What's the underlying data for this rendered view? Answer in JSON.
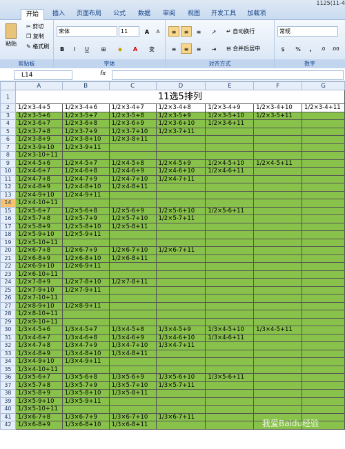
{
  "window": {
    "title_fragment": "1125(11-4"
  },
  "tabs": [
    "开始",
    "插入",
    "页面布局",
    "公式",
    "数据",
    "审阅",
    "视图",
    "开发工具",
    "加载项"
  ],
  "ribbon": {
    "clipboard": {
      "paste": "粘贴",
      "cut": "剪切",
      "copy": "复制",
      "format_painter": "格式刷",
      "label": "剪贴板"
    },
    "font": {
      "name": "宋体",
      "size": "11",
      "bold": "B",
      "italic": "I",
      "underline": "U",
      "grow": "A",
      "shrink": "A",
      "wen": "变",
      "label": "字体"
    },
    "alignment": {
      "wrap": "自动换行",
      "merge": "合并后居中",
      "label": "对齐方式"
    },
    "number": {
      "format": "常规",
      "percent": "%",
      "comma": ",",
      "label": "数字"
    }
  },
  "formula_bar": {
    "name_box": "L14",
    "fx": "fx"
  },
  "columns": [
    "A",
    "B",
    "C",
    "D",
    "E",
    "F",
    "G"
  ],
  "title": "11选5排列",
  "rows": [
    [
      "1/2×3-4+5",
      "1/2×3-4+6",
      "1/2×3-4+7",
      "1/2×3-4+8",
      "1/2×3-4+9",
      "1/2×3-4+10",
      "1/2×3-4+11"
    ],
    [
      "1/2×3-5+6",
      "1/2×3-5+7",
      "1/2×3-5+8",
      "1/2×3-5+9",
      "1/2×3-5+10",
      "1/2×3-5+11",
      ""
    ],
    [
      "1/2×3-6+7",
      "1/2×3-6+8",
      "1/2×3-6+9",
      "1/2×3-6+10",
      "1/2×3-6+11",
      "",
      ""
    ],
    [
      "1/2×3-7+8",
      "1/2×3-7+9",
      "1/2×3-7+10",
      "1/2×3-7+11",
      "",
      "",
      ""
    ],
    [
      "1/2×3-8+9",
      "1/2×3-8+10",
      "1/2×3-8+11",
      "",
      "",
      "",
      ""
    ],
    [
      "1/2×3-9+10",
      "1/2×3-9+11",
      "",
      "",
      "",
      "",
      ""
    ],
    [
      "1/2×3-10+11",
      "",
      "",
      "",
      "",
      "",
      ""
    ],
    [
      "1/2×4-5+6",
      "1/2×4-5+7",
      "1/2×4-5+8",
      "1/2×4-5+9",
      "1/2×4-5+10",
      "1/2×4-5+11",
      ""
    ],
    [
      "1/2×4-6+7",
      "1/2×4-6+8",
      "1/2×4-6+9",
      "1/2×4-6+10",
      "1/2×4-6+11",
      "",
      ""
    ],
    [
      "1/2×4-7+8",
      "1/2×4-7+9",
      "1/2×4-7+10",
      "1/2×4-7+11",
      "",
      "",
      ""
    ],
    [
      "1/2×4-8+9",
      "1/2×4-8+10",
      "1/2×4-8+11",
      "",
      "",
      "",
      ""
    ],
    [
      "1/2×4-9+10",
      "1/2×4-9+11",
      "",
      "",
      "",
      "",
      ""
    ],
    [
      "1/2×4-10+11",
      "",
      "",
      "",
      "",
      "",
      ""
    ],
    [
      "1/2×5-6+7",
      "1/2×5-6+8",
      "1/2×5-6+9",
      "1/2×5-6+10",
      "1/2×5-6+11",
      "",
      ""
    ],
    [
      "1/2×5-7+8",
      "1/2×5-7+9",
      "1/2×5-7+10",
      "1/2×5-7+11",
      "",
      "",
      ""
    ],
    [
      "1/2×5-8+9",
      "1/2×5-8+10",
      "1/2×5-8+11",
      "",
      "",
      "",
      ""
    ],
    [
      "1/2×5-9+10",
      "1/2×5-9+11",
      "",
      "",
      "",
      "",
      ""
    ],
    [
      "1/2×5-10+11",
      "",
      "",
      "",
      "",
      "",
      ""
    ],
    [
      "1/2×6-7+8",
      "1/2×6-7+9",
      "1/2×6-7+10",
      "1/2×6-7+11",
      "",
      "",
      ""
    ],
    [
      "1/2×6-8+9",
      "1/2×6-8+10",
      "1/2×6-8+11",
      "",
      "",
      "",
      ""
    ],
    [
      "1/2×6-9+10",
      "1/2×6-9+11",
      "",
      "",
      "",
      "",
      ""
    ],
    [
      "1/2×6-10+11",
      "",
      "",
      "",
      "",
      "",
      ""
    ],
    [
      "1/2×7-8+9",
      "1/2×7-8+10",
      "1/2×7-8+11",
      "",
      "",
      "",
      ""
    ],
    [
      "1/2×7-9+10",
      "1/2×7-9+11",
      "",
      "",
      "",
      "",
      ""
    ],
    [
      "1/2×7-10+11",
      "",
      "",
      "",
      "",
      "",
      ""
    ],
    [
      "1/2×8-9+10",
      "1/2×8-9+11",
      "",
      "",
      "",
      "",
      ""
    ],
    [
      "1/2×8-10+11",
      "",
      "",
      "",
      "",
      "",
      ""
    ],
    [
      "1/2×9-10+11",
      "",
      "",
      "",
      "",
      "",
      ""
    ],
    [
      "1/3×4-5+6",
      "1/3×4-5+7",
      "1/3×4-5+8",
      "1/3×4-5+9",
      "1/3×4-5+10",
      "1/3×4-5+11",
      ""
    ],
    [
      "1/3×4-6+7",
      "1/3×4-6+8",
      "1/3×4-6+9",
      "1/3×4-6+10",
      "1/3×4-6+11",
      "",
      ""
    ],
    [
      "1/3×4-7+8",
      "1/3×4-7+9",
      "1/3×4-7+10",
      "1/3×4-7+11",
      "",
      "",
      ""
    ],
    [
      "1/3×4-8+9",
      "1/3×4-8+10",
      "1/3×4-8+11",
      "",
      "",
      "",
      ""
    ],
    [
      "1/3×4-9+10",
      "1/3×4-9+11",
      "",
      "",
      "",
      "",
      ""
    ],
    [
      "1/3×4-10+11",
      "",
      "",
      "",
      "",
      "",
      ""
    ],
    [
      "1/3×5-6+7",
      "1/3×5-6+8",
      "1/3×5-6+9",
      "1/3×5-6+10",
      "1/3×5-6+11",
      "",
      ""
    ],
    [
      "1/3×5-7+8",
      "1/3×5-7+9",
      "1/3×5-7+10",
      "1/3×5-7+11",
      "",
      "",
      ""
    ],
    [
      "1/3×5-8+9",
      "1/3×5-8+10",
      "1/3×5-8+11",
      "",
      "",
      "",
      ""
    ],
    [
      "1/3×5-9+10",
      "1/3×5-9+11",
      "",
      "",
      "",
      "",
      ""
    ],
    [
      "1/3×5-10+11",
      "",
      "",
      "",
      "",
      "",
      ""
    ],
    [
      "1/3×6-7+8",
      "1/3×6-7+9",
      "1/3×6-7+10",
      "1/3×6-7+11",
      "",
      "",
      ""
    ],
    [
      "1/3×6-8+9",
      "1/3×6-8+10",
      "1/3×6-8+11",
      "",
      "",
      "",
      ""
    ]
  ],
  "selected_row": 14,
  "watermark": "我爱Baidu经验"
}
